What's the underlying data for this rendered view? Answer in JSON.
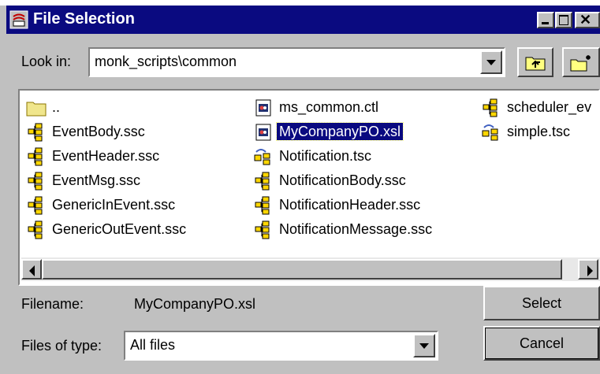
{
  "window": {
    "title": "File Selection"
  },
  "look_in": {
    "label": "Look in:",
    "value": "monk_scripts\\common"
  },
  "files": [
    {
      "name": "..",
      "icon": "folder-icon",
      "selected": false
    },
    {
      "name": "EventBody.ssc",
      "icon": "ssc-file-icon",
      "selected": false
    },
    {
      "name": "EventHeader.ssc",
      "icon": "ssc-file-icon",
      "selected": false
    },
    {
      "name": "EventMsg.ssc",
      "icon": "ssc-file-icon",
      "selected": false
    },
    {
      "name": "GenericInEvent.ssc",
      "icon": "ssc-file-icon",
      "selected": false
    },
    {
      "name": "GenericOutEvent.ssc",
      "icon": "ssc-file-icon",
      "selected": false
    },
    {
      "name": "ms_common.ctl",
      "icon": "ctl-file-icon",
      "selected": false
    },
    {
      "name": "MyCompanyPO.xsl",
      "icon": "xsl-file-icon",
      "selected": true
    },
    {
      "name": "Notification.tsc",
      "icon": "tsc-file-icon",
      "selected": false
    },
    {
      "name": "NotificationBody.ssc",
      "icon": "ssc-file-icon",
      "selected": false
    },
    {
      "name": "NotificationHeader.ssc",
      "icon": "ssc-file-icon",
      "selected": false
    },
    {
      "name": "NotificationMessage.ssc",
      "icon": "ssc-file-icon",
      "selected": false
    },
    {
      "name": "scheduler_ev",
      "icon": "ssc-file-icon",
      "selected": false
    },
    {
      "name": "simple.tsc",
      "icon": "tsc-file-icon",
      "selected": false
    }
  ],
  "filename": {
    "label": "Filename:",
    "value": "MyCompanyPO.xsl"
  },
  "file_type": {
    "label": "Files of type:",
    "value": "All files"
  },
  "buttons": {
    "select": "Select",
    "cancel": "Cancel"
  },
  "colors": {
    "titlebar": "#0a0a80",
    "selection": "#0a0a80",
    "face": "#c0c0c0"
  }
}
